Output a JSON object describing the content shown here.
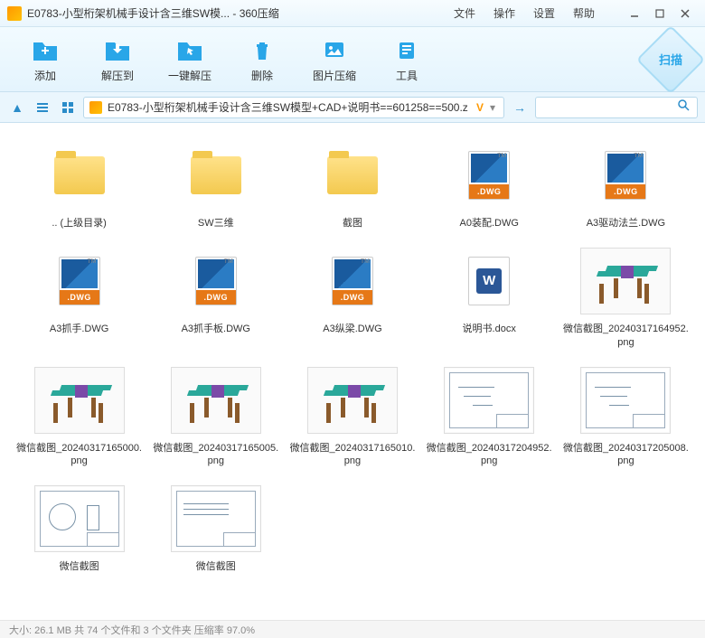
{
  "window": {
    "title": "E0783-小型桁架机械手设计含三维SW模... - 360压缩"
  },
  "menu": {
    "file": "文件",
    "operate": "操作",
    "settings": "设置",
    "help": "帮助"
  },
  "toolbar": {
    "add": "添加",
    "extract_to": "解压到",
    "one_click": "一键解压",
    "delete": "删除",
    "image_compress": "图片压缩",
    "tools": "工具",
    "scan": "扫描"
  },
  "path": {
    "text": "E0783-小型桁架机械手设计含三维SW模型+CAD+说明书==601258==500.z"
  },
  "files": [
    {
      "type": "folder",
      "name": ".. (上级目录)"
    },
    {
      "type": "folder",
      "name": "SW三维"
    },
    {
      "type": "folder",
      "name": "截图"
    },
    {
      "type": "dwg",
      "name": "A0装配.DWG"
    },
    {
      "type": "dwg",
      "name": "A3驱动法兰.DWG"
    },
    {
      "type": "dwg",
      "name": "A3抓手.DWG"
    },
    {
      "type": "dwg",
      "name": "A3抓手板.DWG"
    },
    {
      "type": "dwg",
      "name": "A3纵梁.DWG"
    },
    {
      "type": "docx",
      "name": "说明书.docx"
    },
    {
      "type": "png-render",
      "name": "微信截图_20240317164952.png"
    },
    {
      "type": "png-render",
      "name": "微信截图_20240317165000.png"
    },
    {
      "type": "png-render",
      "name": "微信截图_20240317165005.png"
    },
    {
      "type": "png-render",
      "name": "微信截图_20240317165010.png"
    },
    {
      "type": "png-drawing",
      "name": "微信截图_20240317204952.png"
    },
    {
      "type": "png-drawing",
      "name": "微信截图_20240317205008.png"
    },
    {
      "type": "png-tech",
      "name": "微信截图"
    },
    {
      "type": "png-blank",
      "name": "微信截图"
    }
  ],
  "dwg_band": ".DWG",
  "status": "大小: 26.1 MB 共 74 个文件和 3 个文件夹 压缩率 97.0%"
}
